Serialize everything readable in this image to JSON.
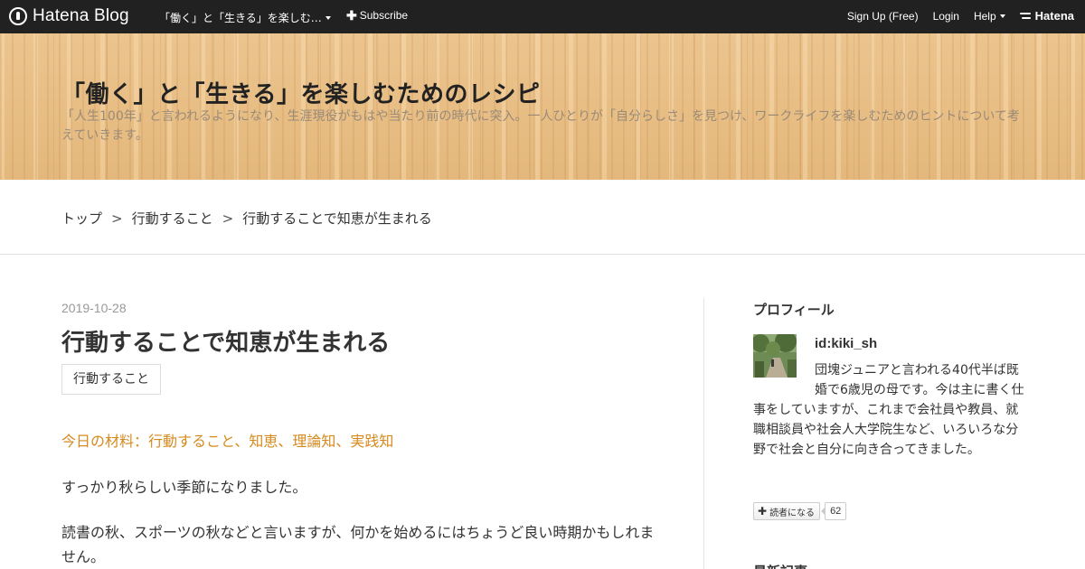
{
  "topbar": {
    "logo_text": "Hatena Blog",
    "blog_menu_label": "「働く」と「生きる」を楽しむ…",
    "subscribe_label": "Subscribe",
    "signup_label": "Sign Up (Free)",
    "login_label": "Login",
    "help_label": "Help",
    "brand_label": "Hatena"
  },
  "header": {
    "title": "「働く」と「生きる」を楽しむためのレシピ",
    "description": "「人生100年」と言われるようになり、生涯現役がもはや当たり前の時代に突入。一人ひとりが「自分らしさ」を見つけ、ワークライフを楽しむためのヒントについて考えていきます。"
  },
  "breadcrumb": {
    "items": [
      "トップ",
      "行動すること",
      "行動することで知恵が生まれる"
    ],
    "separator": ">"
  },
  "article": {
    "date": "2019-10-28",
    "title": "行動することで知恵が生まれる",
    "category": "行動すること",
    "lead": "今日の材料：行動すること、知恵、理論知、実践知",
    "paragraph1": "すっかり秋らしい季節になりました。",
    "paragraph2": "読書の秋、スポーツの秋などと言いますが、何かを始めるにはちょうど良い時期かもしれません。"
  },
  "sidebar": {
    "profile_heading": "プロフィール",
    "profile_id": "id:kiki_sh",
    "profile_description": "団塊ジュニアと言われる40代半ば既婚で6歳児の母です。今は主に書く仕事をしていますが、これまで会社員や教員、就職相談員や社会人大学院生など、いろいろな分野で社会と自分に向き合ってきました。",
    "reader_button_label": "読者になる",
    "reader_count": "62",
    "recent_heading": "最新記事"
  },
  "colors": {
    "topbar_bg": "#212121",
    "lead_accent": "#d68a1e",
    "header_wood": "#e8bf87"
  }
}
